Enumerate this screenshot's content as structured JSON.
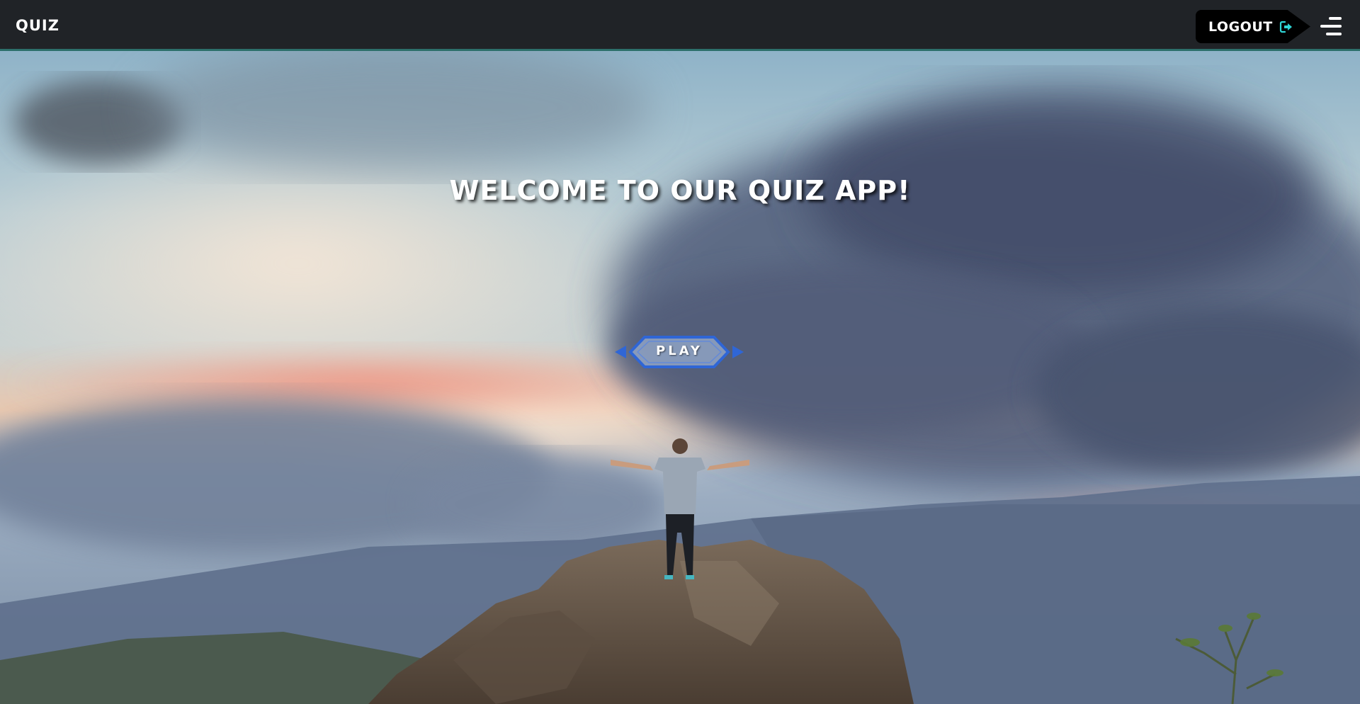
{
  "navbar": {
    "brand": "QUIZ",
    "logout_label": "LOGOUT",
    "logout_icon": "logout-arrow-icon",
    "menu_icon": "hamburger-menu-icon"
  },
  "hero": {
    "headline": "WELCOME TO OUR QUIZ APP!",
    "play_label": "PLAY",
    "background_image": "person-arms-raised-on-mountain-rock-under-cloudy-sunset-sky"
  },
  "colors": {
    "navbar_bg": "#202327",
    "navbar_border": "#2c6f6a",
    "logout_bg": "#000000",
    "logout_icon": "#2fd4d4",
    "play_border": "#2f66d6",
    "play_fill": "#8fa3c4"
  }
}
